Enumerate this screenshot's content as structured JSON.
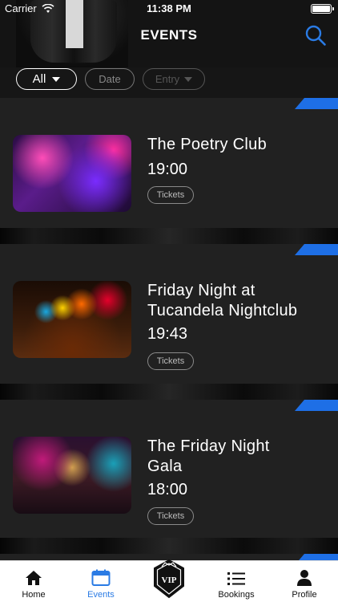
{
  "status_bar": {
    "carrier": "Carrier",
    "time": "11:38 PM"
  },
  "header": {
    "title": "EVENTS"
  },
  "filters": {
    "all_label": "All",
    "date_label": "Date",
    "entry_label": "Entry"
  },
  "events": [
    {
      "title_lines": [
        "The Poetry Club"
      ],
      "time": "19:00",
      "tickets_label": "Tickets"
    },
    {
      "title_lines": [
        "Friday Night at",
        "Tucandela Nightclub"
      ],
      "time": "19:43",
      "tickets_label": "Tickets"
    },
    {
      "title_lines": [
        "The Friday Night",
        "Gala"
      ],
      "time": "18:00",
      "tickets_label": "Tickets"
    }
  ],
  "tab_bar": {
    "tabs": [
      {
        "label": "Home",
        "icon": "home-icon"
      },
      {
        "label": "Events",
        "icon": "calendar-icon",
        "active": true
      },
      {
        "label": "",
        "icon": "vip-icon"
      },
      {
        "label": "Bookings",
        "icon": "list-icon"
      },
      {
        "label": "Profile",
        "icon": "person-icon"
      }
    ],
    "vip_logo_text": "VIP"
  },
  "colors": {
    "accent": "#1e6fe6",
    "active_tab": "#2a7be4",
    "card_bg": "#212121"
  }
}
